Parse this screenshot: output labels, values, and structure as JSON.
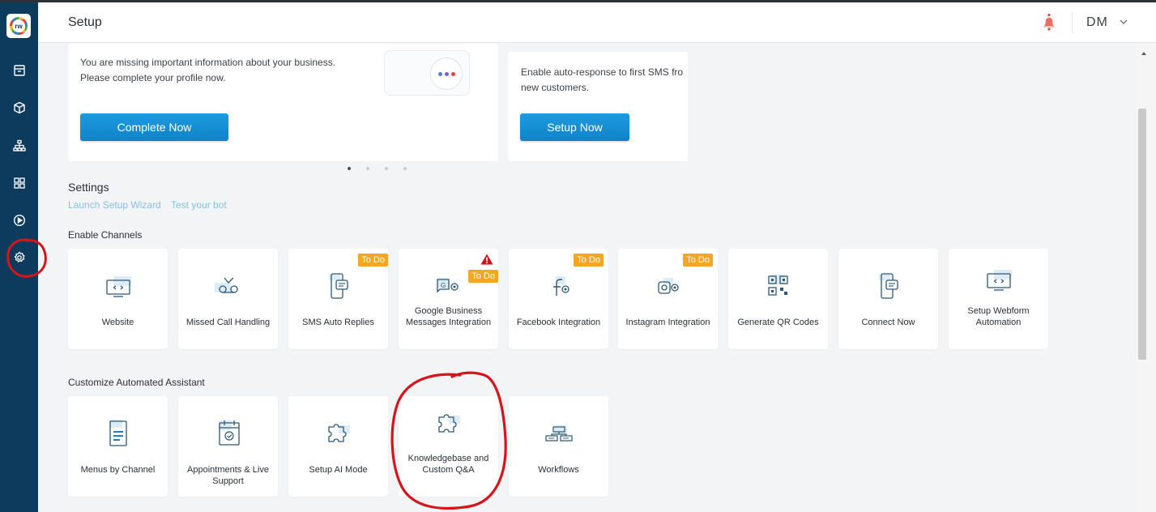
{
  "header": {
    "title": "Setup",
    "user_initials": "DM"
  },
  "sidebar": {
    "logo_text": "rw",
    "items": [
      {
        "name": "archive-icon"
      },
      {
        "name": "box-icon"
      },
      {
        "name": "hierarchy-icon"
      },
      {
        "name": "grid-icon"
      },
      {
        "name": "play-icon"
      },
      {
        "name": "gear-icon",
        "active": true
      }
    ]
  },
  "promos": [
    {
      "text_line1": "You are missing important information about your business.",
      "text_line2": "Please complete your profile now.",
      "button": "Complete Now"
    },
    {
      "text_line1": "Enable auto-response to first SMS fro",
      "text_line2": "new customers.",
      "button": "Setup Now"
    }
  ],
  "carousel": {
    "pages": 4,
    "active": 0
  },
  "settings": {
    "title": "Settings",
    "links": [
      "Launch Setup Wizard",
      "Test your bot"
    ]
  },
  "channels": {
    "title": "Enable Channels",
    "tiles": [
      {
        "label": "Website",
        "icon": "monitor-code-icon"
      },
      {
        "label": "Missed Call Handling",
        "icon": "voicemail-icon"
      },
      {
        "label": "SMS Auto Replies",
        "icon": "phone-message-icon",
        "badge": "To Do"
      },
      {
        "label": "Google Business Messages Integration",
        "icon": "google-gear-icon",
        "badge": "To Do",
        "warning": true
      },
      {
        "label": "Facebook Integration",
        "icon": "facebook-gear-icon",
        "badge": "To Do"
      },
      {
        "label": "Instagram Integration",
        "icon": "instagram-gear-icon",
        "badge": "To Do"
      },
      {
        "label": "Generate QR Codes",
        "icon": "qr-code-icon"
      },
      {
        "label": "Connect Now",
        "icon": "phone-message-icon"
      },
      {
        "label": "Setup Webform Automation",
        "icon": "monitor-code-icon"
      }
    ]
  },
  "assistant": {
    "title": "Customize Automated Assistant",
    "tiles": [
      {
        "label": "Menus by Channel",
        "icon": "document-icon"
      },
      {
        "label": "Appointments & Live Support",
        "icon": "calendar-check-icon"
      },
      {
        "label": "Setup AI Mode",
        "icon": "puzzle-icon"
      },
      {
        "label": "Knowledgebase and Custom Q&A",
        "icon": "puzzle-icon"
      },
      {
        "label": "Workflows",
        "icon": "workflow-icon"
      }
    ]
  },
  "colors": {
    "sidebar": "#0d3b5e",
    "primary_button": "#1493d8",
    "badge": "#f5a623",
    "link": "#8bbfe3",
    "annotation": "#d4161c"
  }
}
